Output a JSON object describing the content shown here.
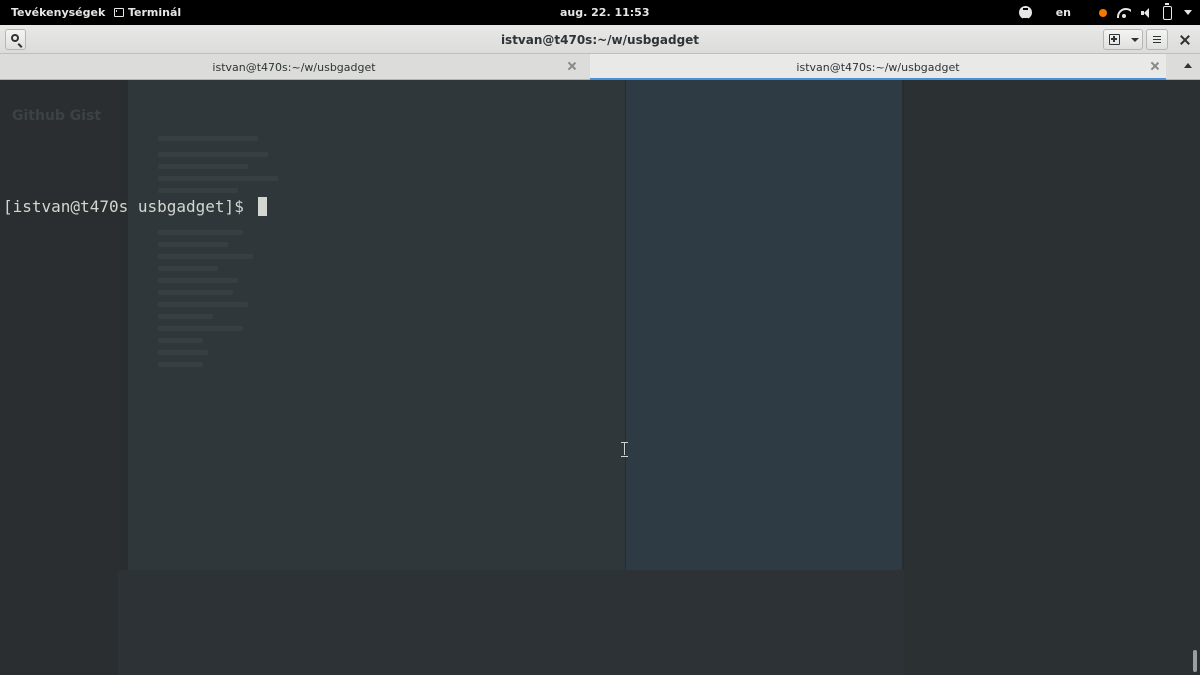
{
  "topbar": {
    "activities": "Tevékenységek",
    "app_name": "Terminál",
    "clock": "aug. 22.  11:53",
    "language": "en",
    "icons": [
      "accessibility-icon",
      "notification-dot-icon",
      "wifi-icon",
      "volume-icon",
      "battery-icon",
      "system-menu-icon"
    ]
  },
  "window": {
    "title": "istvan@t470s:~/w/usbgadget"
  },
  "tabs": [
    {
      "label": "istvan@t470s:~/w/usbgadget",
      "active": false
    },
    {
      "label": "istvan@t470s:~/w/usbgadget",
      "active": true
    }
  ],
  "terminal": {
    "prompt": "[istvan@t470s usbgadget]$ ",
    "background_ghost_text": "Github Gist"
  },
  "colors": {
    "topbar_bg": "#000000",
    "terminal_bg": "#282d2f",
    "terminal_fg": "#d3d7cf",
    "tab_accent": "#4a90d9",
    "notification_dot": "#f57900"
  }
}
